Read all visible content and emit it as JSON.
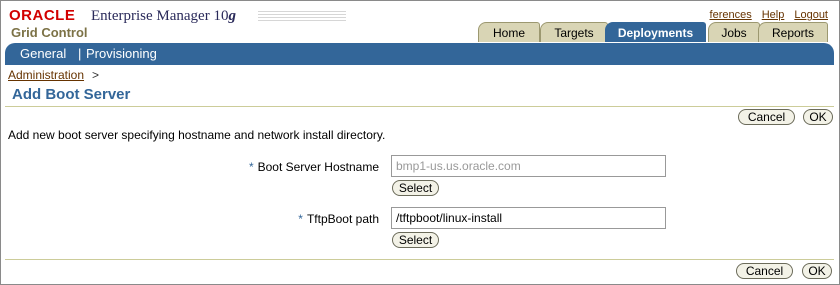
{
  "header": {
    "oracle_logo": "ORACLE",
    "product": "Enterprise Manager 10",
    "product_version": "g",
    "subtitle": "Grid Control",
    "global_links": [
      "ferences",
      "Help",
      "Logout"
    ]
  },
  "tabs": [
    {
      "label": "Home",
      "active": false
    },
    {
      "label": "Targets",
      "active": false
    },
    {
      "label": "Deployments",
      "active": true
    },
    {
      "label": "Jobs",
      "active": false
    },
    {
      "label": "Reports",
      "active": false
    }
  ],
  "subnav": [
    "General",
    "Provisioning"
  ],
  "subnav_separator": "|",
  "breadcrumb": {
    "link": "Administration",
    "separator": ">"
  },
  "page": {
    "title": "Add Boot Server",
    "instruction": "Add new boot server specifying hostname and network install directory."
  },
  "buttons": {
    "cancel": "Cancel",
    "ok": "OK",
    "select": "Select"
  },
  "form": {
    "required_marker": "*",
    "hostname": {
      "label": "Boot Server Hostname",
      "value": "",
      "placeholder": "bmp1-us.us.oracle.com"
    },
    "tftp": {
      "label": "TftpBoot path",
      "value": "/tftpboot/linux-install"
    }
  },
  "colors": {
    "accent": "#336699",
    "tab_inactive": "#d9d5b5",
    "link": "#663300",
    "brand_red": "#d20000"
  }
}
